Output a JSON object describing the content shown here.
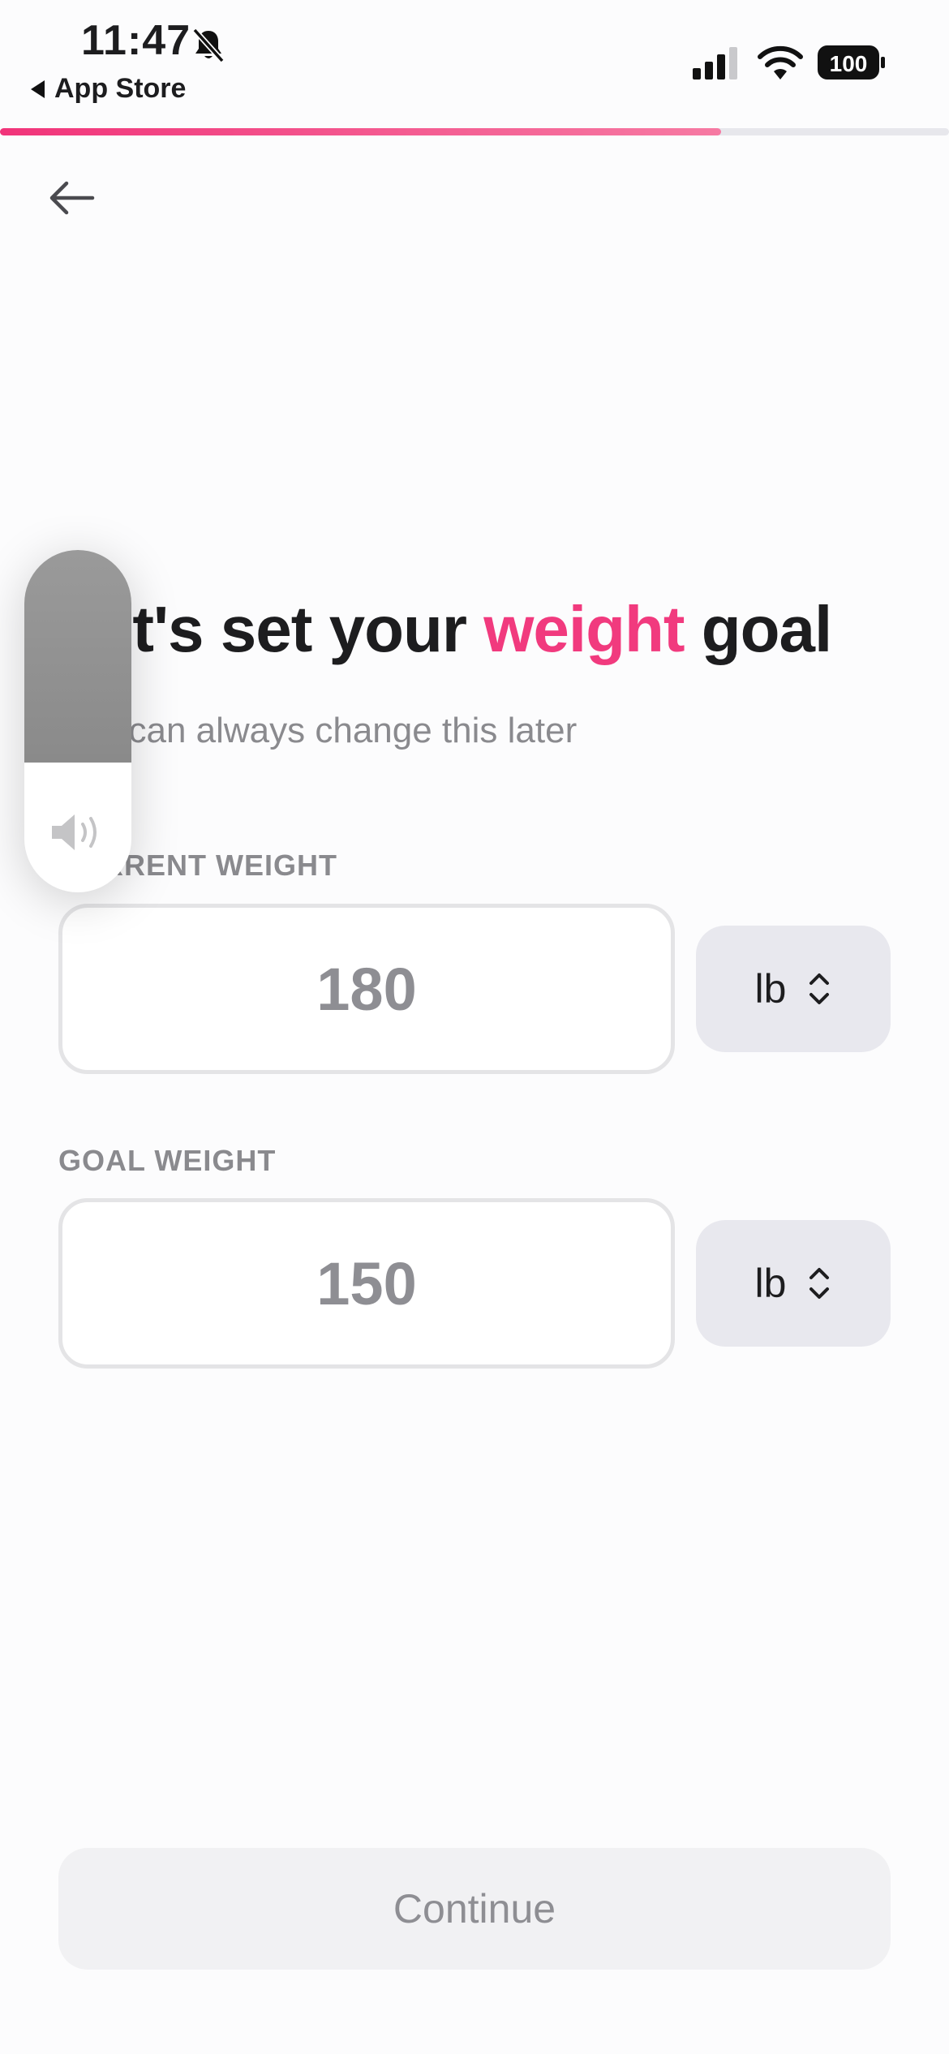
{
  "status_bar": {
    "time": "11:47",
    "back_to_app": "App Store",
    "battery": "100",
    "icons": [
      "bell-slash-icon",
      "cellular-signal-icon",
      "wifi-icon",
      "battery-icon"
    ]
  },
  "progress": {
    "fraction": 0.76,
    "color": "#f13a7e"
  },
  "header": {
    "back_icon": "arrow-left-icon"
  },
  "heading": {
    "title_prefix": "Let's set your ",
    "title_accent": "weight",
    "title_suffix": " goal",
    "subtitle": "You can always change this later"
  },
  "current_weight": {
    "label": "CURRENT WEIGHT",
    "value": "180",
    "unit": "lb"
  },
  "goal_weight": {
    "label": "GOAL WEIGHT",
    "value": "150",
    "unit": "lb"
  },
  "continue_label": "Continue",
  "volume_hud": {
    "level": 0.62,
    "icon": "speaker-icon"
  },
  "colors": {
    "accent": "#f13a7e",
    "muted": "#8e8e93",
    "unit_bg": "#e8e8ee"
  }
}
